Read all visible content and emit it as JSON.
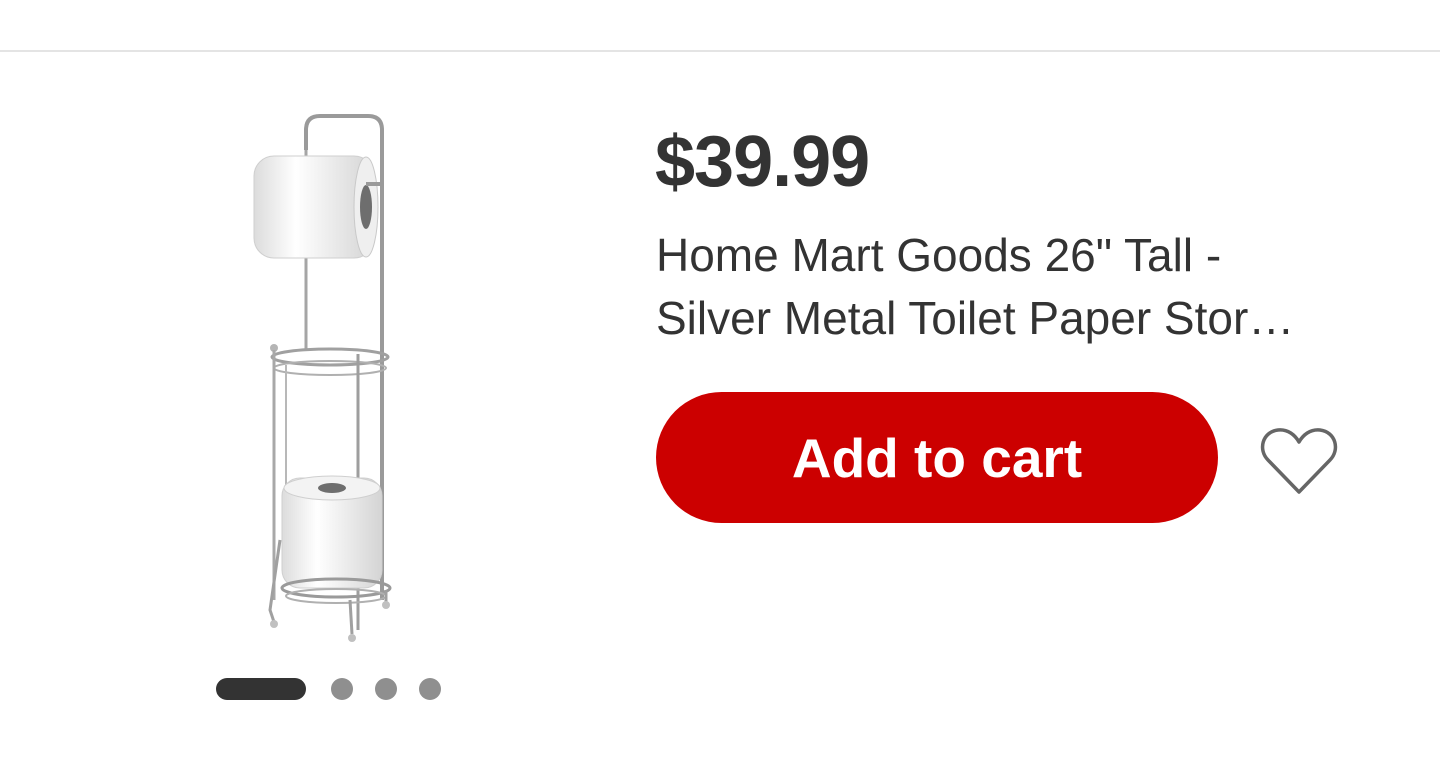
{
  "product": {
    "price": "$39.99",
    "title_line1": "Home Mart Goods 26\" Tall -",
    "title_line2": "Silver Metal Toilet Paper Stor…",
    "image_alt": "Silver metal toilet paper storage stand"
  },
  "actions": {
    "add_to_cart_label": "Add to cart",
    "favorite_icon": "heart-outline-icon"
  },
  "carousel": {
    "total_images": 4,
    "active_index": 0
  },
  "colors": {
    "button": "#cc0000",
    "button_text": "#ffffff",
    "text": "#333333",
    "dot_active": "#333333",
    "dot_inactive": "#8f8f8f",
    "icon": "#666666"
  }
}
